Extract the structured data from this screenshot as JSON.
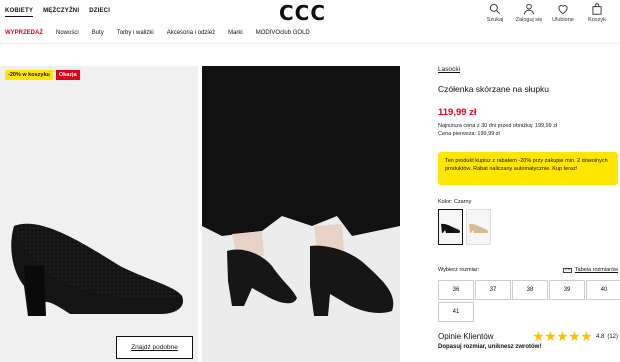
{
  "header": {
    "gender_tabs": [
      "KOBIETY",
      "MĘŻCZYŹNI",
      "DZIECI"
    ],
    "logo": "CCC",
    "utils": [
      {
        "label": "Szukaj",
        "icon": "search-icon"
      },
      {
        "label": "Zaloguj się",
        "icon": "user-icon"
      },
      {
        "label": "Ulubione",
        "icon": "heart-icon"
      },
      {
        "label": "Koszyk",
        "icon": "bag-icon"
      }
    ]
  },
  "nav": [
    "WYPRZEDAŻ",
    "Nowości",
    "Buty",
    "Torby i walizki",
    "Akcesoria i odzież",
    "Marki",
    "MODIVOclub GOLD"
  ],
  "gallery": {
    "badge_discount": "-20% w koszyku",
    "badge_deal": "Okazja",
    "similar_button": "Znajdź podobne"
  },
  "product": {
    "brand": "Lasocki",
    "title": "Czółenka skórzane na słupku",
    "price": "119,99 zł",
    "lowest_price": "Najniższa cena z 30 dni przed obniżką: 199,99 zł",
    "first_price": "Cena pierwsza: 199,99 zł",
    "promo": "Ten produkt kupisz z rabatem -20% przy zakupie min. 2 dowolnych produktów. Rabat naliczany automatycznie. Kup teraz!",
    "color_label": "Kolor: Czarny",
    "size_label": "Wybierz rozmiar:",
    "size_table": "Tabela rozmiarów",
    "sizes": [
      "36",
      "37",
      "38",
      "39",
      "40",
      "41"
    ],
    "reviews_title": "Opinie Klientów",
    "rating": "4.8",
    "review_count": "(12)",
    "reviews_sub": "Dopasuj rozmiar, uniknesz zwrotów!"
  },
  "colors": {
    "sale": "#e2001a",
    "promo": "#ffe600",
    "star": "#ffbf00"
  }
}
